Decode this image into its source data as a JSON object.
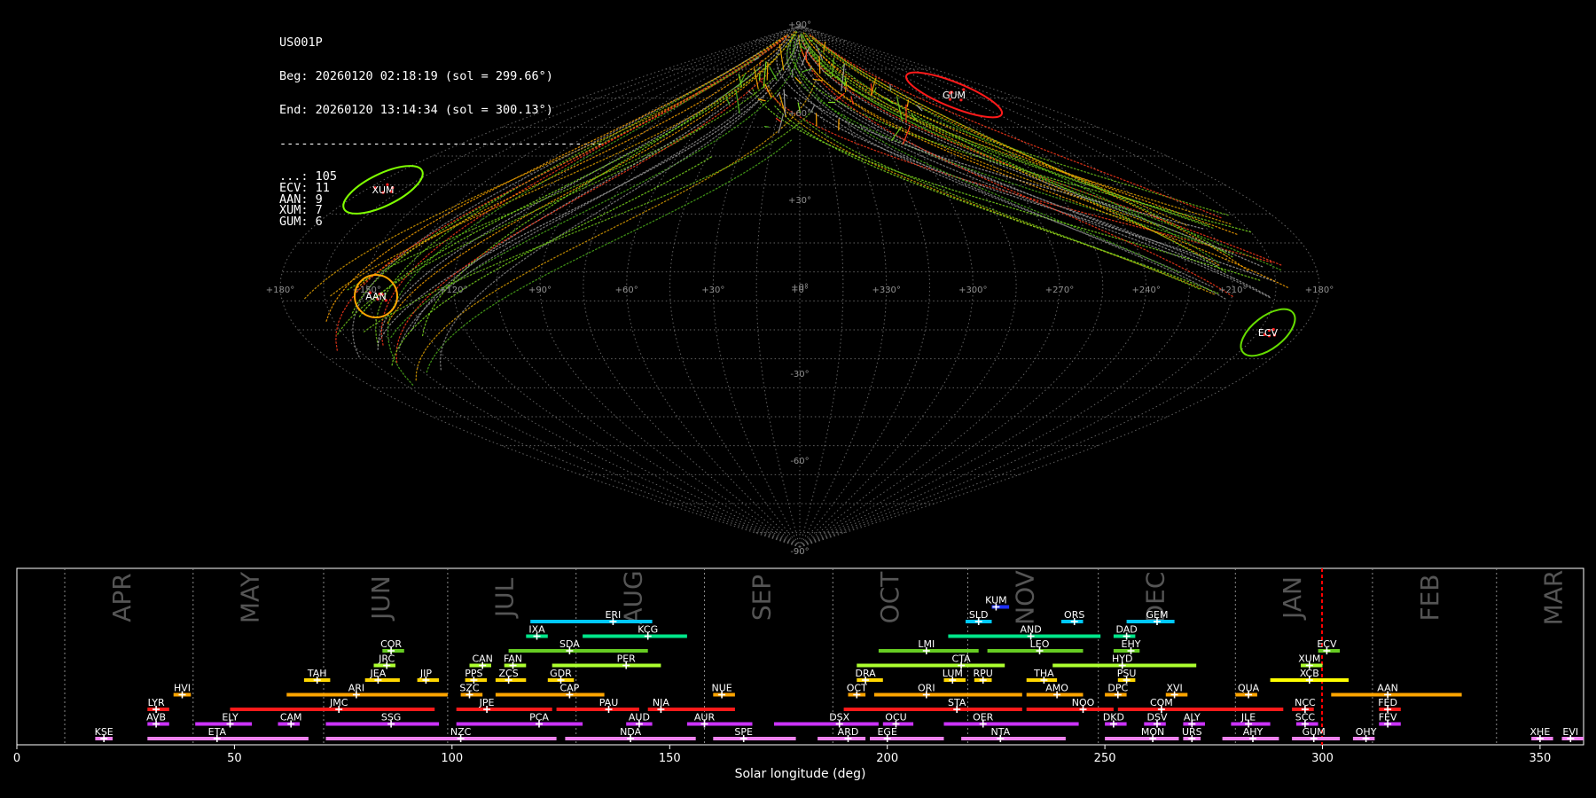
{
  "info": {
    "station": "US001P",
    "begin": "Beg: 20260120 02:18:19 (sol = 299.66°)",
    "end": "End: 20260120 13:14:34 (sol = 300.13°)",
    "separator": "---------------------------------------------",
    "counts": [
      {
        "code": "...",
        "n": "105"
      },
      {
        "code": "ECV",
        "n": "11"
      },
      {
        "code": "AAN",
        "n": "9"
      },
      {
        "code": "XUM",
        "n": "7"
      },
      {
        "code": "GUM",
        "n": "6"
      }
    ]
  },
  "sky_map": {
    "projection": "sinusoidal",
    "lon_labels": [
      "+180°",
      "+150°",
      "+120°",
      "+90°",
      "+60°",
      "+30°",
      "+0°",
      "+330°",
      "+300°",
      "+270°",
      "+240°",
      "+210°",
      "+180°"
    ],
    "lat_labels": [
      "+90°",
      "+60°",
      "+30°",
      "+0°",
      "-30°",
      "-60°",
      "-90°"
    ],
    "radiants": [
      {
        "name": "XUM",
        "color": "#7fff00"
      },
      {
        "name": "AAN",
        "color": "#ffa500"
      },
      {
        "name": "GUM",
        "color": "#ff1a1a"
      },
      {
        "name": "ECV",
        "color": "#66dd00"
      }
    ]
  },
  "chart_data": {
    "type": "timeline",
    "xlabel": "Solar longitude (deg)",
    "xlim": [
      0,
      360
    ],
    "xticks": [
      0,
      50,
      100,
      150,
      200,
      250,
      300,
      350
    ],
    "current_sol": 299.9,
    "months": [
      {
        "label": "APR",
        "start": 11,
        "end": 40.5
      },
      {
        "label": "MAY",
        "start": 40.5,
        "end": 70.5
      },
      {
        "label": "JUN",
        "start": 70.5,
        "end": 99
      },
      {
        "label": "JUL",
        "start": 99,
        "end": 128.5
      },
      {
        "label": "AUG",
        "start": 128.5,
        "end": 158
      },
      {
        "label": "SEP",
        "start": 158,
        "end": 187.5
      },
      {
        "label": "OCT",
        "start": 187.5,
        "end": 218.5
      },
      {
        "label": "NOV",
        "start": 218.5,
        "end": 248.5
      },
      {
        "label": "DEC",
        "start": 248.5,
        "end": 280
      },
      {
        "label": "JAN",
        "start": 280,
        "end": 311.5
      },
      {
        "label": "FEB",
        "start": 311.5,
        "end": 340
      },
      {
        "label": "MAR",
        "start": 340,
        "end": 371
      }
    ],
    "showers": [
      {
        "code": "KUM",
        "row": 9,
        "start": 224,
        "end": 228,
        "peak": 225,
        "color": "#1e30ff"
      },
      {
        "code": "ERI",
        "row": 8,
        "start": 118,
        "end": 146,
        "peak": 137,
        "color": "#00c8ff"
      },
      {
        "code": "SLD",
        "row": 8,
        "start": 218,
        "end": 224,
        "peak": 221,
        "color": "#00c8ff"
      },
      {
        "code": "ORS",
        "row": 8,
        "start": 240,
        "end": 245,
        "peak": 243,
        "color": "#00c8ff"
      },
      {
        "code": "GEM",
        "row": 8,
        "start": 255,
        "end": 266,
        "peak": 262,
        "color": "#00c8ff"
      },
      {
        "code": "IXA",
        "row": 7,
        "start": 117,
        "end": 122,
        "peak": 119.5,
        "color": "#00e68a"
      },
      {
        "code": "KCG",
        "row": 7,
        "start": 130,
        "end": 154,
        "peak": 145,
        "color": "#00e68a"
      },
      {
        "code": "AND",
        "row": 7,
        "start": 214,
        "end": 249,
        "peak": 233,
        "color": "#00e68a"
      },
      {
        "code": "DAD",
        "row": 7,
        "start": 252,
        "end": 257,
        "peak": 255,
        "color": "#00e68a"
      },
      {
        "code": "COR",
        "row": 6,
        "start": 84,
        "end": 89,
        "peak": 86,
        "color": "#66cc22"
      },
      {
        "code": "SDA",
        "row": 6,
        "start": 113,
        "end": 145,
        "peak": 127,
        "color": "#66cc22"
      },
      {
        "code": "LMI",
        "row": 6,
        "start": 198,
        "end": 221,
        "peak": 209,
        "color": "#66cc22"
      },
      {
        "code": "LEO",
        "row": 6,
        "start": 223,
        "end": 245,
        "peak": 235,
        "color": "#66cc22"
      },
      {
        "code": "EHY",
        "row": 6,
        "start": 252,
        "end": 258,
        "peak": 256,
        "color": "#66cc22"
      },
      {
        "code": "ECV",
        "row": 6,
        "start": 299,
        "end": 304,
        "peak": 301,
        "color": "#66cc22"
      },
      {
        "code": "JRC",
        "row": 5,
        "start": 82,
        "end": 87,
        "peak": 85,
        "color": "#adff2f"
      },
      {
        "code": "CAN",
        "row": 5,
        "start": 104,
        "end": 109,
        "peak": 107,
        "color": "#adff2f"
      },
      {
        "code": "FAN",
        "row": 5,
        "start": 112,
        "end": 117,
        "peak": 114,
        "color": "#adff2f"
      },
      {
        "code": "PER",
        "row": 5,
        "start": 123,
        "end": 148,
        "peak": 140,
        "color": "#adff2f"
      },
      {
        "code": "CTA",
        "row": 5,
        "start": 193,
        "end": 227,
        "peak": 217,
        "color": "#adff2f"
      },
      {
        "code": "HYD",
        "row": 5,
        "start": 238,
        "end": 271,
        "peak": 254,
        "color": "#adff2f"
      },
      {
        "code": "XUM",
        "row": 5,
        "start": 295,
        "end": 300,
        "peak": 297,
        "color": "#adff2f"
      },
      {
        "code": "TAH",
        "row": 4,
        "start": 66,
        "end": 72,
        "peak": 69,
        "color": "#ffd700"
      },
      {
        "code": "JEA",
        "row": 4,
        "start": 80,
        "end": 88,
        "peak": 83,
        "color": "#ffd700"
      },
      {
        "code": "JIP",
        "row": 4,
        "start": 92,
        "end": 97,
        "peak": 94,
        "color": "#ffd700"
      },
      {
        "code": "PPS",
        "row": 4,
        "start": 103,
        "end": 108,
        "peak": 105,
        "color": "#ffd700"
      },
      {
        "code": "ZCS",
        "row": 4,
        "start": 110,
        "end": 117,
        "peak": 113,
        "color": "#ffd700"
      },
      {
        "code": "GDR",
        "row": 4,
        "start": 122,
        "end": 128,
        "peak": 125,
        "color": "#ffd700"
      },
      {
        "code": "DRA",
        "row": 4,
        "start": 193,
        "end": 199,
        "peak": 195,
        "color": "#ffd700"
      },
      {
        "code": "LUM",
        "row": 4,
        "start": 213,
        "end": 218,
        "peak": 215,
        "color": "#ffd700"
      },
      {
        "code": "RPU",
        "row": 4,
        "start": 220,
        "end": 224,
        "peak": 222,
        "color": "#ffd700"
      },
      {
        "code": "THA",
        "row": 4,
        "start": 232,
        "end": 239,
        "peak": 236,
        "color": "#ffd700"
      },
      {
        "code": "PSU",
        "row": 4,
        "start": 253,
        "end": 257,
        "peak": 255,
        "color": "#ffd700"
      },
      {
        "code": "XCB",
        "row": 4,
        "start": 288,
        "end": 306,
        "peak": 297,
        "color": "#ffff00"
      },
      {
        "code": "HVI",
        "row": 3,
        "start": 36,
        "end": 40,
        "peak": 38,
        "color": "#ffa500"
      },
      {
        "code": "ARI",
        "row": 3,
        "start": 62,
        "end": 99,
        "peak": 78,
        "color": "#ffa500"
      },
      {
        "code": "SZC",
        "row": 3,
        "start": 102,
        "end": 107,
        "peak": 104,
        "color": "#ffa500"
      },
      {
        "code": "CAP",
        "row": 3,
        "start": 110,
        "end": 135,
        "peak": 127,
        "color": "#ffa500"
      },
      {
        "code": "NUE",
        "row": 3,
        "start": 160,
        "end": 165,
        "peak": 162,
        "color": "#ffa500"
      },
      {
        "code": "OCT",
        "row": 3,
        "start": 191,
        "end": 195,
        "peak": 193,
        "color": "#ffa500"
      },
      {
        "code": "ORI",
        "row": 3,
        "start": 197,
        "end": 231,
        "peak": 209,
        "color": "#ffa500"
      },
      {
        "code": "AMO",
        "row": 3,
        "start": 232,
        "end": 245,
        "peak": 239,
        "color": "#ffa500"
      },
      {
        "code": "DPC",
        "row": 3,
        "start": 250,
        "end": 255,
        "peak": 253,
        "color": "#ffa500"
      },
      {
        "code": "XVI",
        "row": 3,
        "start": 264,
        "end": 269,
        "peak": 266,
        "color": "#ffa500"
      },
      {
        "code": "QUA",
        "row": 3,
        "start": 280,
        "end": 285,
        "peak": 283,
        "color": "#ffa500"
      },
      {
        "code": "AAN",
        "row": 3,
        "start": 302,
        "end": 332,
        "peak": 315,
        "color": "#ffa500"
      },
      {
        "code": "LYR",
        "row": 2,
        "start": 30,
        "end": 35,
        "peak": 32,
        "color": "#ff1a1a"
      },
      {
        "code": "JMC",
        "row": 2,
        "start": 49,
        "end": 96,
        "peak": 74,
        "color": "#ff1a1a"
      },
      {
        "code": "JPE",
        "row": 2,
        "start": 101,
        "end": 123,
        "peak": 108,
        "color": "#ff1a1a"
      },
      {
        "code": "PAU",
        "row": 2,
        "start": 124,
        "end": 143,
        "peak": 136,
        "color": "#ff1a1a"
      },
      {
        "code": "NIA",
        "row": 2,
        "start": 145,
        "end": 165,
        "peak": 148,
        "color": "#ff1a1a"
      },
      {
        "code": "STA",
        "row": 2,
        "start": 190,
        "end": 231,
        "peak": 216,
        "color": "#ff1a1a"
      },
      {
        "code": "NOO",
        "row": 2,
        "start": 232,
        "end": 252,
        "peak": 245,
        "color": "#ff1a1a"
      },
      {
        "code": "COM",
        "row": 2,
        "start": 253,
        "end": 291,
        "peak": 263,
        "color": "#ff1a1a"
      },
      {
        "code": "NCC",
        "row": 2,
        "start": 293,
        "end": 298,
        "peak": 296,
        "color": "#ff1a1a"
      },
      {
        "code": "FED",
        "row": 2,
        "start": 313,
        "end": 318,
        "peak": 315,
        "color": "#ff1a1a"
      },
      {
        "code": "AVB",
        "row": 1,
        "start": 30,
        "end": 35,
        "peak": 32,
        "color": "#cc33ff"
      },
      {
        "code": "ELY",
        "row": 1,
        "start": 41,
        "end": 54,
        "peak": 49,
        "color": "#cc33ff"
      },
      {
        "code": "CAM",
        "row": 1,
        "start": 60,
        "end": 65,
        "peak": 63,
        "color": "#cc33ff"
      },
      {
        "code": "SSG",
        "row": 1,
        "start": 71,
        "end": 97,
        "peak": 86,
        "color": "#cc33ff"
      },
      {
        "code": "PCA",
        "row": 1,
        "start": 101,
        "end": 130,
        "peak": 120,
        "color": "#cc33ff"
      },
      {
        "code": "AUD",
        "row": 1,
        "start": 140,
        "end": 146,
        "peak": 143,
        "color": "#cc33ff"
      },
      {
        "code": "AUR",
        "row": 1,
        "start": 154,
        "end": 169,
        "peak": 158,
        "color": "#cc33ff"
      },
      {
        "code": "DSX",
        "row": 1,
        "start": 174,
        "end": 198,
        "peak": 189,
        "color": "#cc33ff"
      },
      {
        "code": "OCU",
        "row": 1,
        "start": 199,
        "end": 206,
        "peak": 202,
        "color": "#cc33ff"
      },
      {
        "code": "OER",
        "row": 1,
        "start": 213,
        "end": 244,
        "peak": 222,
        "color": "#cc33ff"
      },
      {
        "code": "DKD",
        "row": 1,
        "start": 250,
        "end": 255,
        "peak": 252,
        "color": "#cc33ff"
      },
      {
        "code": "DSV",
        "row": 1,
        "start": 259,
        "end": 264,
        "peak": 262,
        "color": "#cc33ff"
      },
      {
        "code": "ALY",
        "row": 1,
        "start": 268,
        "end": 273,
        "peak": 270,
        "color": "#cc33ff"
      },
      {
        "code": "JLE",
        "row": 1,
        "start": 279,
        "end": 288,
        "peak": 283,
        "color": "#cc33ff"
      },
      {
        "code": "SCC",
        "row": 1,
        "start": 294,
        "end": 299,
        "peak": 296,
        "color": "#cc33ff"
      },
      {
        "code": "FEV",
        "row": 1,
        "start": 313,
        "end": 318,
        "peak": 315,
        "color": "#cc33ff"
      },
      {
        "code": "KSE",
        "row": 0,
        "start": 18,
        "end": 22,
        "peak": 20,
        "color": "#ee82ee"
      },
      {
        "code": "ETA",
        "row": 0,
        "start": 30,
        "end": 67,
        "peak": 46,
        "color": "#ee82ee"
      },
      {
        "code": "NZC",
        "row": 0,
        "start": 71,
        "end": 124,
        "peak": 102,
        "color": "#ee82ee"
      },
      {
        "code": "NDA",
        "row": 0,
        "start": 126,
        "end": 156,
        "peak": 141,
        "color": "#ee82ee"
      },
      {
        "code": "SPE",
        "row": 0,
        "start": 160,
        "end": 179,
        "peak": 167,
        "color": "#ee82ee"
      },
      {
        "code": "ARD",
        "row": 0,
        "start": 184,
        "end": 195,
        "peak": 191,
        "color": "#ee82ee"
      },
      {
        "code": "EGE",
        "row": 0,
        "start": 196,
        "end": 213,
        "peak": 200,
        "color": "#ee82ee"
      },
      {
        "code": "NTA",
        "row": 0,
        "start": 217,
        "end": 241,
        "peak": 226,
        "color": "#ee82ee"
      },
      {
        "code": "MON",
        "row": 0,
        "start": 250,
        "end": 267,
        "peak": 261,
        "color": "#ee82ee"
      },
      {
        "code": "URS",
        "row": 0,
        "start": 268,
        "end": 272,
        "peak": 270,
        "color": "#ee82ee"
      },
      {
        "code": "AHY",
        "row": 0,
        "start": 277,
        "end": 290,
        "peak": 284,
        "color": "#ee82ee"
      },
      {
        "code": "GUM",
        "row": 0,
        "start": 293,
        "end": 304,
        "peak": 298,
        "color": "#ee82ee"
      },
      {
        "code": "OHY",
        "row": 0,
        "start": 307,
        "end": 312,
        "peak": 310,
        "color": "#ee82ee"
      },
      {
        "code": "XHE",
        "row": 0,
        "start": 348,
        "end": 353,
        "peak": 350,
        "color": "#ee82ee"
      },
      {
        "code": "EVI",
        "row": 0,
        "start": 355,
        "end": 360,
        "peak": 357,
        "color": "#ee82ee"
      }
    ]
  }
}
